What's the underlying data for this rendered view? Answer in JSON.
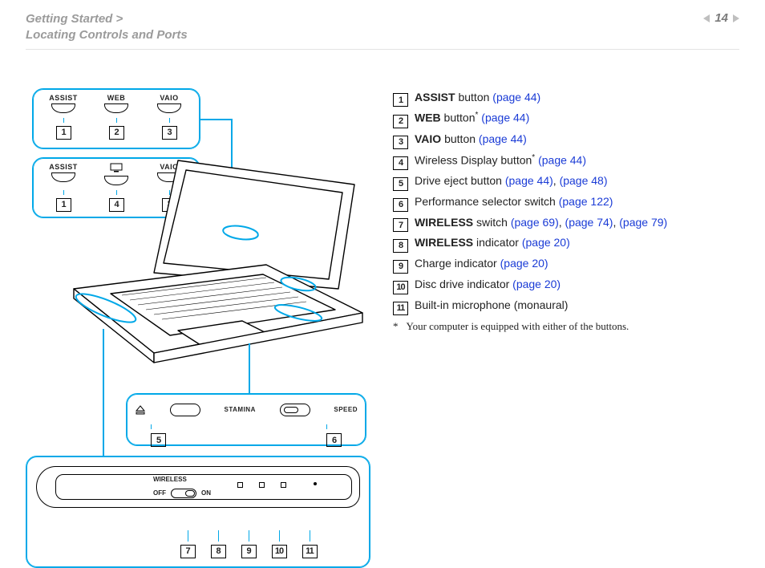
{
  "breadcrumb": {
    "section": "Getting Started",
    "separator": ">",
    "page_title": "Locating Controls and Ports"
  },
  "page_number": "14",
  "diagram": {
    "panelA": {
      "buttons": [
        "ASSIST",
        "WEB",
        "VAIO"
      ],
      "callouts": [
        "1",
        "2",
        "3"
      ]
    },
    "panelB": {
      "buttons": [
        "ASSIST",
        "",
        "VAIO"
      ],
      "middle_is_icon": true,
      "callouts": [
        "1",
        "4",
        "3"
      ]
    },
    "panelC": {
      "eject_icon": "eject-icon",
      "labels": [
        "STAMINA",
        "SPEED"
      ],
      "callouts": [
        "5",
        "6"
      ]
    },
    "panelD": {
      "wireless_label": "WIRELESS",
      "off_label": "OFF",
      "on_label": "ON",
      "callouts": [
        "7",
        "8",
        "9",
        "10",
        "11"
      ]
    }
  },
  "legend": [
    {
      "num": "1",
      "bold": "ASSIST",
      "text": " button ",
      "links": [
        "(page 44)"
      ]
    },
    {
      "num": "2",
      "bold": "WEB",
      "text": " button",
      "sup": "*",
      "links": [
        "(page 44)"
      ]
    },
    {
      "num": "3",
      "bold": "VAIO",
      "text": " button ",
      "links": [
        "(page 44)"
      ]
    },
    {
      "num": "4",
      "bold": "",
      "text": "Wireless Display button",
      "sup": "*",
      "links": [
        "(page 44)"
      ]
    },
    {
      "num": "5",
      "bold": "",
      "text": "Drive eject button ",
      "links": [
        "(page 44)",
        "(page 48)"
      ],
      "sep": ", "
    },
    {
      "num": "6",
      "bold": "",
      "text": "Performance selector switch ",
      "links": [
        "(page 122)"
      ]
    },
    {
      "num": "7",
      "bold": "WIRELESS",
      "text": " switch ",
      "links": [
        "(page 69)",
        "(page 74)",
        "(page 79)"
      ],
      "sep": ", "
    },
    {
      "num": "8",
      "bold": "WIRELESS",
      "text": " indicator ",
      "links": [
        "(page 20)"
      ]
    },
    {
      "num": "9",
      "bold": "",
      "text": "Charge indicator ",
      "links": [
        "(page 20)"
      ]
    },
    {
      "num": "10",
      "bold": "",
      "text": "Disc drive indicator ",
      "links": [
        "(page 20)"
      ]
    },
    {
      "num": "11",
      "bold": "",
      "text": "Built-in microphone (monaural)",
      "links": []
    }
  ],
  "footnote": {
    "mark": "*",
    "text": "Your computer is equipped with either of the buttons."
  }
}
